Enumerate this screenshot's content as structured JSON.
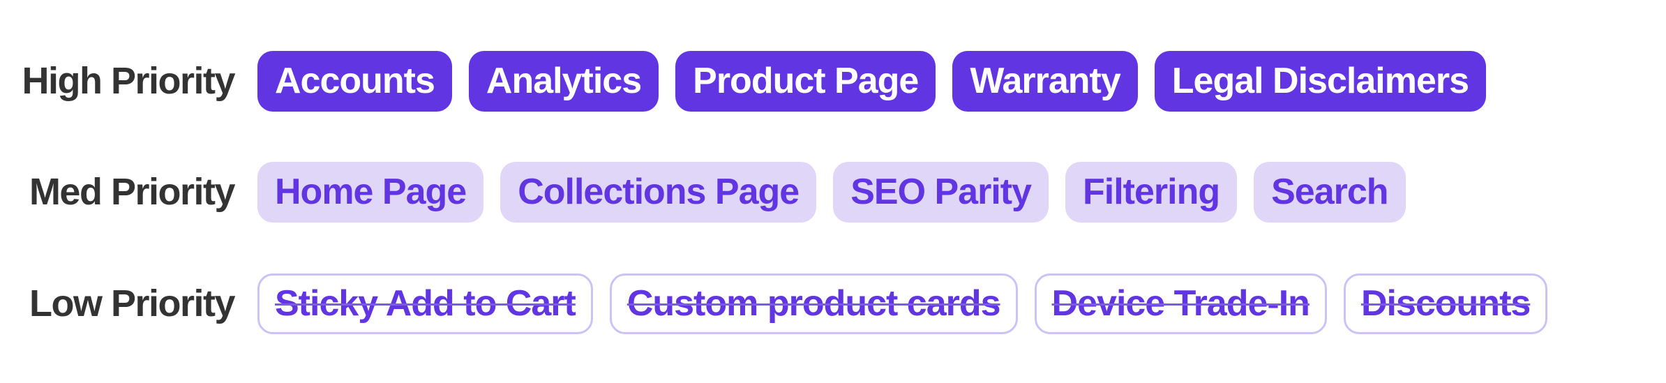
{
  "colors": {
    "primary": "#6235E3",
    "primary_light_bg": "#E0D7F8",
    "outline_border": "#CCC2F5",
    "label_text": "#333333",
    "background": "#FFFFFF"
  },
  "rows": [
    {
      "label": "High Priority",
      "style": "filled",
      "tags": [
        {
          "label": "Accounts",
          "struck": false
        },
        {
          "label": "Analytics",
          "struck": false
        },
        {
          "label": "Product Page",
          "struck": false
        },
        {
          "label": "Warranty",
          "struck": false
        },
        {
          "label": "Legal Disclaimers",
          "struck": false
        }
      ]
    },
    {
      "label": "Med Priority",
      "style": "tinted",
      "tags": [
        {
          "label": "Home Page",
          "struck": false
        },
        {
          "label": "Collections Page",
          "struck": false
        },
        {
          "label": "SEO Parity",
          "struck": false
        },
        {
          "label": "Filtering",
          "struck": false
        },
        {
          "label": "Search",
          "struck": false
        }
      ]
    },
    {
      "label": "Low Priority",
      "style": "outlined",
      "tags": [
        {
          "label": "Sticky Add to Cart",
          "struck": true
        },
        {
          "label": "Custom product cards",
          "struck": true
        },
        {
          "label": "Device Trade-In",
          "struck": true
        },
        {
          "label": "Discounts",
          "struck": true
        }
      ]
    }
  ]
}
